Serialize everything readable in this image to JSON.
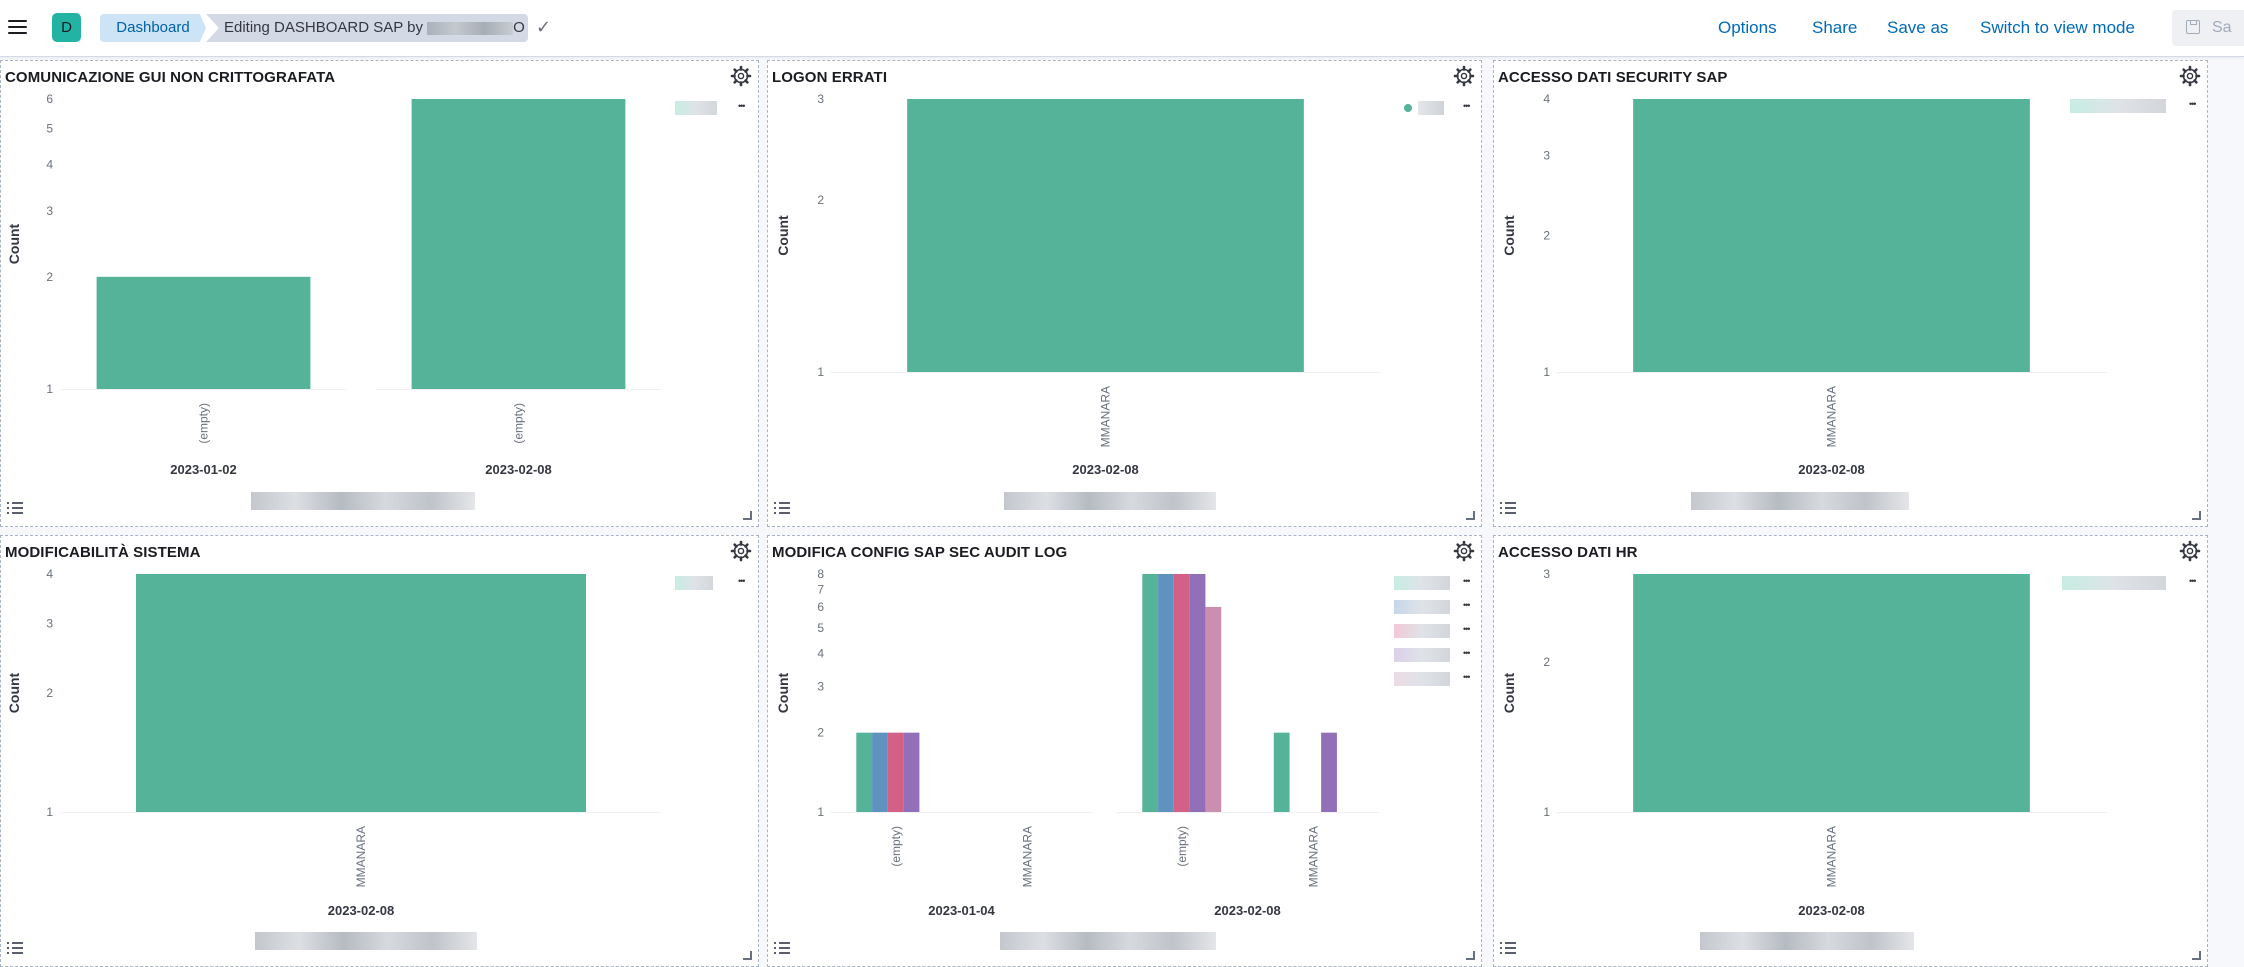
{
  "app": {
    "space_initial": "D",
    "breadcrumb_root": "Dashboard",
    "breadcrumb_current_prefix": "Editing DASHBOARD SAP by",
    "breadcrumb_current_suffix": "O"
  },
  "topnav": {
    "options": "Options",
    "share": "Share",
    "save_as": "Save as",
    "switch_view": "Switch to view mode",
    "save": "Sa"
  },
  "colors": {
    "accent": "#006bb8",
    "series": [
      "#54b399",
      "#6092c0",
      "#d36086",
      "#9170b8",
      "#ca8eae"
    ]
  },
  "panels": [
    {
      "title": "COMUNICAZIONE GUI NON CRITTOGRAFATA"
    },
    {
      "title": "LOGON ERRATI"
    },
    {
      "title": "ACCESSO DATI SECURITY SAP"
    },
    {
      "title": "MODIFICABILITÀ SISTEMA"
    },
    {
      "title": "MODIFICA CONFIG SAP SEC AUDIT LOG"
    },
    {
      "title": "ACCESSO DATI HR"
    }
  ],
  "chart_data": [
    {
      "type": "bar",
      "title": "COMUNICAZIONE GUI NON CRITTOGRAFATA",
      "ylabel": "Count",
      "y_scale": "log",
      "ylim": [
        1,
        6
      ],
      "yticks": [
        1,
        2,
        3,
        4,
        5,
        6
      ],
      "facets": [
        {
          "label": "2023-01-02",
          "categories": [
            "(empty)"
          ],
          "series": [
            {
              "values": [
                2
              ]
            }
          ]
        },
        {
          "label": "2023-02-08",
          "categories": [
            "(empty)"
          ],
          "series": [
            {
              "values": [
                6
              ]
            }
          ]
        }
      ]
    },
    {
      "type": "bar",
      "title": "LOGON ERRATI",
      "ylabel": "Count",
      "y_scale": "log",
      "ylim": [
        1,
        3
      ],
      "yticks": [
        1,
        2,
        3
      ],
      "facets": [
        {
          "label": "2023-02-08",
          "categories": [
            "MMANARA"
          ],
          "series": [
            {
              "values": [
                3
              ]
            }
          ]
        }
      ]
    },
    {
      "type": "bar",
      "title": "ACCESSO DATI SECURITY SAP",
      "ylabel": "Count",
      "y_scale": "log",
      "ylim": [
        1,
        4
      ],
      "yticks": [
        1,
        2,
        3,
        4
      ],
      "facets": [
        {
          "label": "2023-02-08",
          "categories": [
            "MMANARA"
          ],
          "series": [
            {
              "values": [
                4
              ]
            }
          ]
        }
      ]
    },
    {
      "type": "bar",
      "title": "MODIFICABILITÀ SISTEMA",
      "ylabel": "Count",
      "y_scale": "log",
      "ylim": [
        1,
        4
      ],
      "yticks": [
        1,
        2,
        3,
        4
      ],
      "facets": [
        {
          "label": "2023-02-08",
          "categories": [
            "MMANARA"
          ],
          "series": [
            {
              "values": [
                4
              ]
            }
          ]
        }
      ]
    },
    {
      "type": "bar",
      "title": "MODIFICA CONFIG SAP SEC AUDIT LOG",
      "ylabel": "Count",
      "y_scale": "log",
      "ylim": [
        1,
        8
      ],
      "yticks": [
        1,
        2,
        3,
        4,
        5,
        6,
        7,
        8
      ],
      "facets": [
        {
          "label": "2023-01-04",
          "categories": [
            "(empty)",
            "MMANARA"
          ],
          "series": [
            {
              "values": [
                2,
                0
              ]
            },
            {
              "values": [
                2,
                0
              ]
            },
            {
              "values": [
                2,
                0
              ]
            },
            {
              "values": [
                2,
                0
              ]
            },
            {
              "values": [
                0,
                0
              ]
            }
          ]
        },
        {
          "label": "2023-02-08",
          "categories": [
            "(empty)",
            "MMANARA"
          ],
          "series": [
            {
              "values": [
                8,
                2
              ]
            },
            {
              "values": [
                8,
                0
              ]
            },
            {
              "values": [
                8,
                0
              ]
            },
            {
              "values": [
                8,
                2
              ]
            },
            {
              "values": [
                6,
                0
              ]
            }
          ]
        }
      ]
    },
    {
      "type": "bar",
      "title": "ACCESSO DATI HR",
      "ylabel": "Count",
      "y_scale": "log",
      "ylim": [
        1,
        3
      ],
      "yticks": [
        1,
        2,
        3
      ],
      "facets": [
        {
          "label": "2023-02-08",
          "categories": [
            "MMANARA"
          ],
          "series": [
            {
              "values": [
                3
              ]
            }
          ]
        }
      ]
    }
  ]
}
